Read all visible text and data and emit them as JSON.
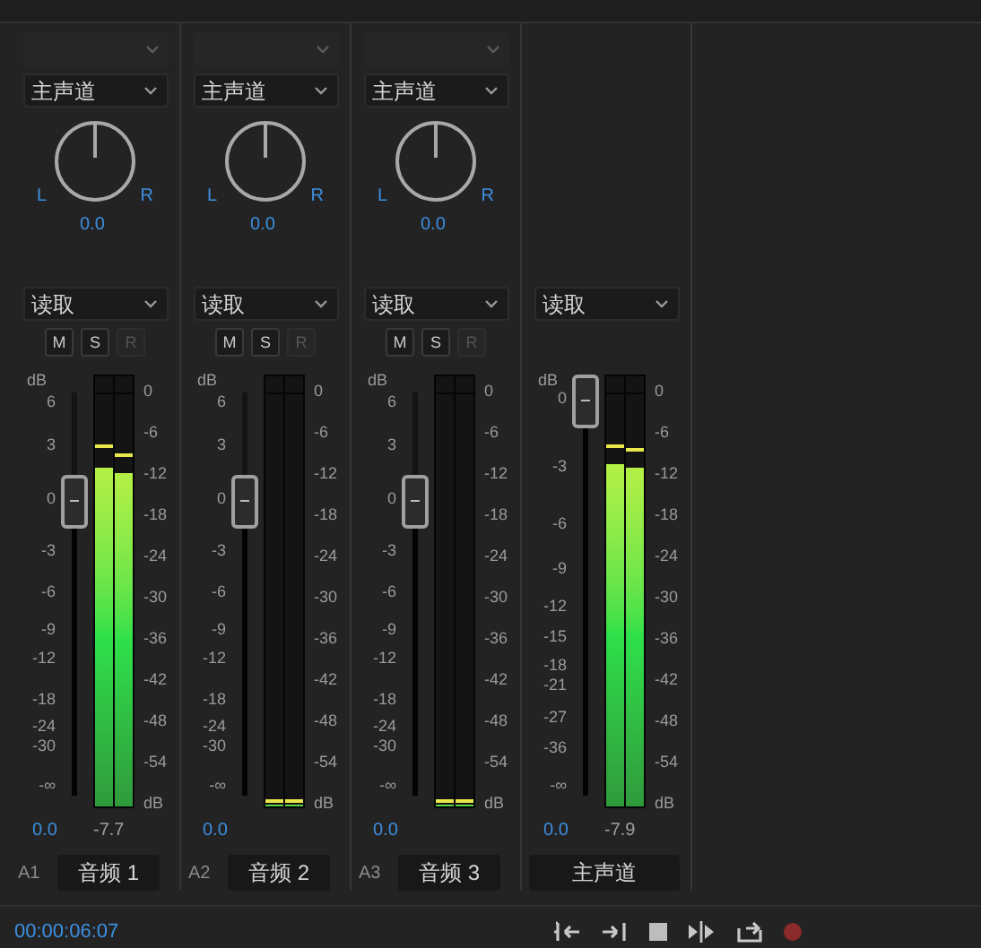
{
  "panel": {
    "strips": [
      {
        "kind": "track",
        "input": {
          "disabled": true
        },
        "output": "主声道",
        "pan": {
          "left": "L",
          "right": "R",
          "value": "0.0"
        },
        "automation": "读取",
        "buttons": [
          {
            "label": "M",
            "disabled": false
          },
          {
            "label": "S",
            "disabled": false
          },
          {
            "label": "R",
            "disabled": true
          }
        ],
        "fader": {
          "unit": "dB",
          "scale": [
            "6",
            "3",
            "0",
            "-3",
            "-6",
            "-9",
            "-12",
            "-18",
            "-24",
            "-30",
            "-∞"
          ],
          "level": 0.73
        },
        "meter": {
          "channels": [
            {
              "level": 0.82,
              "peak_hold": {
                "level": 0.87
              }
            },
            {
              "level": 0.81,
              "peak_hold": {
                "level": 0.85
              }
            }
          ],
          "scale": [
            "0",
            "-6",
            "-12",
            "-18",
            "-24",
            "-30",
            "-36",
            "-42",
            "-48",
            "-54",
            "dB"
          ]
        },
        "volume": "0.0",
        "peak_reading": "-7.7",
        "track_id": "A1",
        "name": "音频 1"
      },
      {
        "kind": "track",
        "input": {
          "disabled": true
        },
        "output": "主声道",
        "pan": {
          "left": "L",
          "right": "R",
          "value": "0.0"
        },
        "automation": "读取",
        "buttons": [
          {
            "label": "M",
            "disabled": false
          },
          {
            "label": "S",
            "disabled": false
          },
          {
            "label": "R",
            "disabled": true
          }
        ],
        "fader": {
          "unit": "dB",
          "scale": [
            "6",
            "3",
            "0",
            "-3",
            "-6",
            "-9",
            "-12",
            "-18",
            "-24",
            "-30",
            "-∞"
          ],
          "level": 0.73
        },
        "meter": {
          "channels": [
            {
              "level": 0,
              "peak_hold": {
                "level": 0.01
              }
            },
            {
              "level": 0,
              "peak_hold": {
                "level": 0.01
              }
            }
          ],
          "scale": [
            "0",
            "-6",
            "-12",
            "-18",
            "-24",
            "-30",
            "-36",
            "-42",
            "-48",
            "-54",
            "dB"
          ]
        },
        "volume": "0.0",
        "track_id": "A2",
        "name": "音频 2"
      },
      {
        "kind": "track",
        "input": {
          "disabled": true
        },
        "output": "主声道",
        "pan": {
          "left": "L",
          "right": "R",
          "value": "0.0"
        },
        "automation": "读取",
        "buttons": [
          {
            "label": "M",
            "disabled": false
          },
          {
            "label": "S",
            "disabled": false
          },
          {
            "label": "R",
            "disabled": true
          }
        ],
        "fader": {
          "unit": "dB",
          "scale": [
            "6",
            "3",
            "0",
            "-3",
            "-6",
            "-9",
            "-12",
            "-18",
            "-24",
            "-30",
            "-∞"
          ],
          "level": 0.73
        },
        "meter": {
          "channels": [
            {
              "level": 0,
              "peak_hold": {
                "level": 0.01
              }
            },
            {
              "level": 0,
              "peak_hold": {
                "level": 0.01
              }
            }
          ],
          "scale": [
            "0",
            "-6",
            "-12",
            "-18",
            "-24",
            "-30",
            "-36",
            "-42",
            "-48",
            "-54",
            "dB"
          ]
        },
        "volume": "0.0",
        "track_id": "A3",
        "name": "音频 3"
      },
      {
        "kind": "master",
        "automation": "读取",
        "fader": {
          "unit": "dB",
          "scale": [
            "0",
            "-3",
            "-6",
            "-9",
            "-12",
            "-15",
            "-18",
            "-21",
            "-27",
            "-36",
            "-∞"
          ],
          "level": 0.98
        },
        "meter": {
          "channels": [
            {
              "level": 0.83,
              "peak_hold": {
                "level": 0.87
              }
            },
            {
              "level": 0.82,
              "peak_hold": {
                "level": 0.86
              }
            }
          ],
          "scale": [
            "0",
            "-6",
            "-12",
            "-18",
            "-24",
            "-30",
            "-36",
            "-42",
            "-48",
            "-54",
            "dB"
          ]
        },
        "volume": "0.0",
        "peak_reading": "-7.9",
        "name": "主声道"
      }
    ]
  },
  "footer": {
    "timecode": "00:00:06:07"
  }
}
